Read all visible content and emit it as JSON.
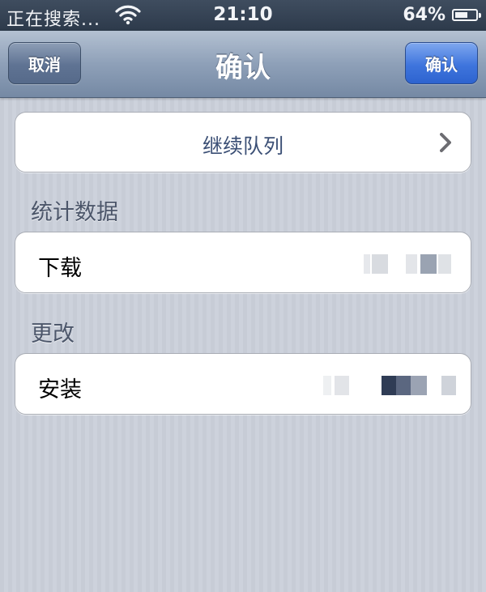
{
  "status_bar": {
    "carrier": "正在搜索...",
    "time": "21:10",
    "battery_percent": "64%",
    "battery_level": 0.64,
    "wifi_icon": "wifi-icon"
  },
  "nav": {
    "title": "确认",
    "cancel_label": "取消",
    "confirm_label": "确认"
  },
  "continue_queue": {
    "label": "继续队列",
    "icon": "chevron-right-icon"
  },
  "sections": {
    "stats": {
      "header": "统计数据",
      "row_label": "下载"
    },
    "changes": {
      "header": "更改",
      "row_label": "安装"
    }
  },
  "colors": {
    "confirm_button": "#3f75dd",
    "cell_accent_text": "#3b4f75",
    "header_text": "#4c566a"
  }
}
